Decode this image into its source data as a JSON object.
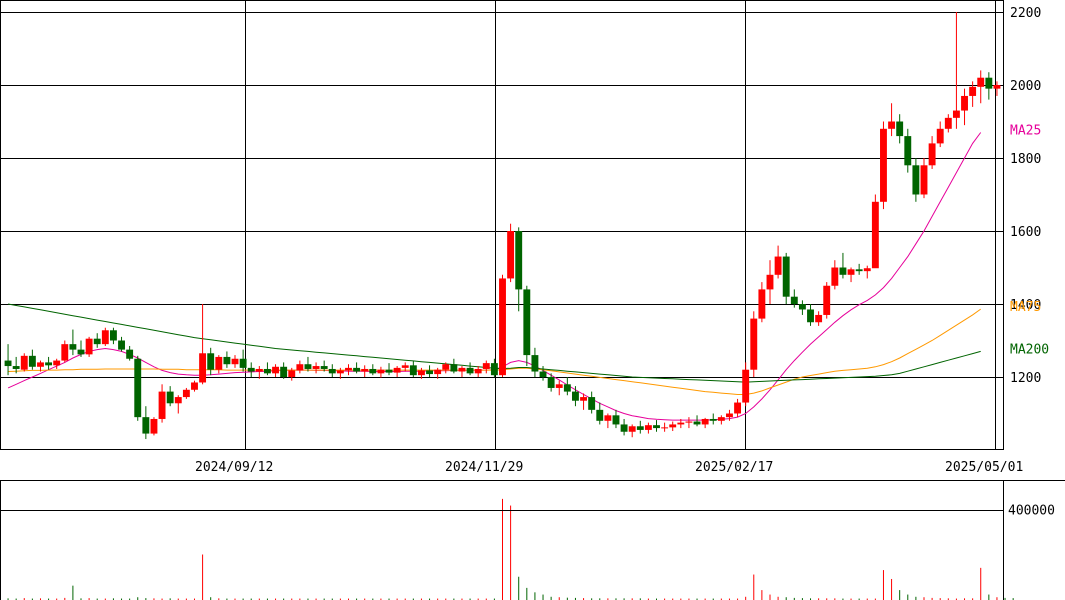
{
  "chart_data": [
    {
      "type": "candlestick",
      "panel": "price",
      "x_ticks": [
        "2024/09/12",
        "2024/11/29",
        "2025/02/17",
        "2025/05/01"
      ],
      "y_ticks": [
        1200,
        1400,
        1600,
        1800,
        2000,
        2200
      ],
      "ylim": [
        1020,
        2220
      ],
      "grid": true,
      "up_color": "#ff0000",
      "down_color": "#006400",
      "candles": [
        [
          1245,
          1290,
          1205,
          1230
        ],
        [
          1230,
          1255,
          1210,
          1222
        ],
        [
          1220,
          1265,
          1215,
          1258
        ],
        [
          1258,
          1275,
          1220,
          1228
        ],
        [
          1228,
          1245,
          1215,
          1240
        ],
        [
          1240,
          1255,
          1220,
          1232
        ],
        [
          1232,
          1250,
          1222,
          1245
        ],
        [
          1245,
          1300,
          1240,
          1290
        ],
        [
          1290,
          1330,
          1260,
          1275
        ],
        [
          1275,
          1300,
          1255,
          1262
        ],
        [
          1262,
          1310,
          1255,
          1305
        ],
        [
          1305,
          1320,
          1280,
          1290
        ],
        [
          1290,
          1335,
          1285,
          1328
        ],
        [
          1328,
          1335,
          1290,
          1300
        ],
        [
          1300,
          1310,
          1270,
          1275
        ],
        [
          1275,
          1285,
          1245,
          1250
        ],
        [
          1250,
          1258,
          1080,
          1090
        ],
        [
          1090,
          1120,
          1030,
          1045
        ],
        [
          1045,
          1090,
          1040,
          1085
        ],
        [
          1085,
          1180,
          1075,
          1160
        ],
        [
          1160,
          1175,
          1120,
          1128
        ],
        [
          1128,
          1150,
          1100,
          1145
        ],
        [
          1145,
          1170,
          1140,
          1165
        ],
        [
          1165,
          1190,
          1160,
          1185
        ],
        [
          1185,
          1400,
          1180,
          1265
        ],
        [
          1265,
          1280,
          1205,
          1220
        ],
        [
          1220,
          1260,
          1210,
          1255
        ],
        [
          1255,
          1270,
          1225,
          1235
        ],
        [
          1235,
          1260,
          1225,
          1250
        ],
        [
          1250,
          1275,
          1215,
          1225
        ],
        [
          1225,
          1240,
          1200,
          1215
        ],
        [
          1215,
          1230,
          1195,
          1222
        ],
        [
          1222,
          1240,
          1205,
          1210
        ],
        [
          1210,
          1235,
          1200,
          1228
        ],
        [
          1228,
          1240,
          1195,
          1200
        ],
        [
          1200,
          1225,
          1190,
          1218
        ],
        [
          1218,
          1245,
          1210,
          1235
        ],
        [
          1235,
          1255,
          1215,
          1222
        ],
        [
          1222,
          1240,
          1210,
          1230
        ],
        [
          1230,
          1245,
          1215,
          1222
        ],
        [
          1222,
          1235,
          1200,
          1210
        ],
        [
          1210,
          1225,
          1195,
          1218
        ],
        [
          1218,
          1235,
          1205,
          1225
        ],
        [
          1225,
          1240,
          1210,
          1215
        ],
        [
          1215,
          1232,
          1200,
          1222
        ],
        [
          1222,
          1235,
          1205,
          1210
        ],
        [
          1210,
          1228,
          1198,
          1220
        ],
        [
          1220,
          1238,
          1205,
          1212
        ],
        [
          1212,
          1230,
          1200,
          1225
        ],
        [
          1225,
          1240,
          1215,
          1232
        ],
        [
          1232,
          1245,
          1200,
          1205
        ],
        [
          1205,
          1225,
          1195,
          1218
        ],
        [
          1218,
          1232,
          1200,
          1208
        ],
        [
          1208,
          1225,
          1195,
          1220
        ],
        [
          1220,
          1240,
          1210,
          1235
        ],
        [
          1235,
          1250,
          1210,
          1215
        ],
        [
          1215,
          1230,
          1200,
          1225
        ],
        [
          1225,
          1240,
          1205,
          1210
        ],
        [
          1210,
          1230,
          1200,
          1222
        ],
        [
          1222,
          1245,
          1210,
          1238
        ],
        [
          1238,
          1250,
          1200,
          1205
        ],
        [
          1205,
          1480,
          1200,
          1470
        ],
        [
          1470,
          1620,
          1460,
          1600
        ],
        [
          1600,
          1610,
          1380,
          1440
        ],
        [
          1440,
          1450,
          1230,
          1260
        ],
        [
          1260,
          1280,
          1200,
          1215
        ],
        [
          1215,
          1230,
          1190,
          1200
        ],
        [
          1200,
          1210,
          1160,
          1170
        ],
        [
          1170,
          1190,
          1150,
          1180
        ],
        [
          1180,
          1200,
          1150,
          1160
        ],
        [
          1160,
          1175,
          1120,
          1135
        ],
        [
          1135,
          1155,
          1110,
          1145
        ],
        [
          1145,
          1160,
          1100,
          1110
        ],
        [
          1110,
          1130,
          1070,
          1080
        ],
        [
          1080,
          1100,
          1060,
          1095
        ],
        [
          1095,
          1110,
          1060,
          1070
        ],
        [
          1070,
          1085,
          1040,
          1050
        ],
        [
          1050,
          1070,
          1035,
          1065
        ],
        [
          1065,
          1080,
          1045,
          1055
        ],
        [
          1055,
          1075,
          1045,
          1068
        ],
        [
          1068,
          1082,
          1050,
          1060
        ],
        [
          1060,
          1075,
          1050,
          1062
        ],
        [
          1062,
          1078,
          1052,
          1070
        ],
        [
          1070,
          1085,
          1060,
          1075
        ],
        [
          1075,
          1090,
          1060,
          1078
        ],
        [
          1078,
          1095,
          1065,
          1070
        ],
        [
          1070,
          1088,
          1060,
          1085
        ],
        [
          1085,
          1100,
          1070,
          1080
        ],
        [
          1080,
          1095,
          1070,
          1090
        ],
        [
          1090,
          1110,
          1080,
          1100
        ],
        [
          1100,
          1140,
          1090,
          1130
        ],
        [
          1130,
          1240,
          1120,
          1220
        ],
        [
          1220,
          1380,
          1200,
          1360
        ],
        [
          1360,
          1460,
          1350,
          1440
        ],
        [
          1440,
          1520,
          1400,
          1480
        ],
        [
          1480,
          1560,
          1470,
          1530
        ],
        [
          1530,
          1540,
          1400,
          1420
        ],
        [
          1420,
          1440,
          1390,
          1400
        ],
        [
          1400,
          1410,
          1370,
          1385
        ],
        [
          1385,
          1400,
          1340,
          1350
        ],
        [
          1350,
          1380,
          1340,
          1370
        ],
        [
          1370,
          1460,
          1360,
          1450
        ],
        [
          1450,
          1520,
          1440,
          1500
        ],
        [
          1500,
          1540,
          1470,
          1480
        ],
        [
          1480,
          1500,
          1460,
          1495
        ],
        [
          1495,
          1510,
          1480,
          1490
        ],
        [
          1490,
          1505,
          1470,
          1498
        ],
        [
          1498,
          1700,
          1620,
          1680
        ],
        [
          1680,
          1900,
          1660,
          1880
        ],
        [
          1880,
          1950,
          1860,
          1900
        ],
        [
          1900,
          1920,
          1840,
          1860
        ],
        [
          1860,
          1880,
          1760,
          1780
        ],
        [
          1780,
          1800,
          1680,
          1700
        ],
        [
          1700,
          1800,
          1690,
          1780
        ],
        [
          1780,
          1860,
          1770,
          1840
        ],
        [
          1840,
          1900,
          1830,
          1880
        ],
        [
          1880,
          1920,
          1870,
          1910
        ],
        [
          1910,
          2200,
          1880,
          1930
        ],
        [
          1930,
          1990,
          1890,
          1970
        ],
        [
          1970,
          2010,
          1940,
          1995
        ],
        [
          1995,
          2040,
          1950,
          2020
        ],
        [
          2020,
          2035,
          1960,
          1990
        ],
        [
          1990,
          2010,
          1970,
          2000
        ]
      ],
      "series": [
        {
          "name": "MA25",
          "color": "#e6009a",
          "values": [
            1170,
            1180,
            1190,
            1200,
            1210,
            1220,
            1230,
            1240,
            1252,
            1262,
            1270,
            1275,
            1278,
            1275,
            1270,
            1262,
            1252,
            1240,
            1228,
            1218,
            1212,
            1208,
            1206,
            1205,
            1205,
            1206,
            1208,
            1210,
            1212,
            1213,
            1214,
            1215,
            1216,
            1217,
            1218,
            1219,
            1219,
            1219,
            1218,
            1218,
            1217,
            1217,
            1216,
            1216,
            1216,
            1215,
            1215,
            1215,
            1215,
            1216,
            1216,
            1216,
            1217,
            1217,
            1217,
            1218,
            1218,
            1218,
            1219,
            1219,
            1220,
            1228,
            1240,
            1245,
            1240,
            1230,
            1218,
            1205,
            1192,
            1178,
            1165,
            1152,
            1140,
            1128,
            1118,
            1108,
            1100,
            1094,
            1090,
            1086,
            1084,
            1083,
            1082,
            1082,
            1082,
            1082,
            1082,
            1083,
            1084,
            1086,
            1090,
            1100,
            1118,
            1140,
            1165,
            1192,
            1220,
            1245,
            1268,
            1290,
            1310,
            1330,
            1350,
            1368,
            1384,
            1398,
            1410,
            1425,
            1445,
            1470,
            1500,
            1530,
            1565,
            1600,
            1640,
            1680,
            1720,
            1760,
            1800,
            1840,
            1870
          ]
        },
        {
          "name": "MA75",
          "color": "#ff9900",
          "values": [
            1215,
            1216,
            1217,
            1218,
            1218,
            1219,
            1219,
            1220,
            1220,
            1221,
            1221,
            1221,
            1222,
            1222,
            1222,
            1222,
            1222,
            1222,
            1222,
            1221,
            1221,
            1221,
            1220,
            1220,
            1220,
            1220,
            1220,
            1219,
            1219,
            1219,
            1219,
            1219,
            1219,
            1219,
            1219,
            1219,
            1219,
            1219,
            1219,
            1219,
            1219,
            1219,
            1219,
            1219,
            1219,
            1219,
            1219,
            1219,
            1219,
            1219,
            1219,
            1219,
            1219,
            1219,
            1219,
            1219,
            1219,
            1219,
            1219,
            1219,
            1219,
            1220,
            1222,
            1224,
            1224,
            1222,
            1220,
            1217,
            1214,
            1211,
            1208,
            1205,
            1202,
            1199,
            1196,
            1193,
            1190,
            1187,
            1184,
            1181,
            1178,
            1175,
            1172,
            1169,
            1166,
            1163,
            1160,
            1158,
            1156,
            1154,
            1152,
            1152,
            1156,
            1162,
            1170,
            1178,
            1186,
            1194,
            1200,
            1204,
            1208,
            1212,
            1216,
            1218,
            1220,
            1222,
            1224,
            1228,
            1234,
            1242,
            1252,
            1264,
            1276,
            1288,
            1300,
            1314,
            1328,
            1342,
            1356,
            1370,
            1386
          ]
        },
        {
          "name": "MA200",
          "color": "#006400",
          "values": [
            1400,
            1396,
            1392,
            1388,
            1384,
            1380,
            1376,
            1372,
            1368,
            1364,
            1360,
            1356,
            1352,
            1348,
            1344,
            1340,
            1336,
            1332,
            1328,
            1324,
            1320,
            1316,
            1312,
            1308,
            1305,
            1302,
            1299,
            1296,
            1293,
            1290,
            1287,
            1284,
            1281,
            1278,
            1276,
            1274,
            1272,
            1270,
            1268,
            1266,
            1264,
            1262,
            1260,
            1258,
            1256,
            1254,
            1252,
            1250,
            1248,
            1246,
            1244,
            1242,
            1240,
            1238,
            1236,
            1234,
            1232,
            1230,
            1228,
            1226,
            1224,
            1223,
            1224,
            1226,
            1226,
            1224,
            1222,
            1220,
            1218,
            1216,
            1214,
            1212,
            1210,
            1208,
            1206,
            1204,
            1202,
            1200,
            1199,
            1198,
            1197,
            1196,
            1195,
            1194,
            1193,
            1192,
            1191,
            1190,
            1189,
            1188,
            1187,
            1186,
            1187,
            1188,
            1189,
            1190,
            1191,
            1192,
            1193,
            1194,
            1195,
            1196,
            1197,
            1198,
            1199,
            1200,
            1201,
            1202,
            1204,
            1206,
            1210,
            1216,
            1222,
            1228,
            1234,
            1240,
            1246,
            1252,
            1258,
            1264,
            1270
          ]
        }
      ],
      "ma_labels": [
        "MA25",
        "MA75",
        "MA200"
      ]
    },
    {
      "type": "bar",
      "panel": "volume",
      "y_ticks": [
        400000
      ],
      "ylim": [
        0,
        530000
      ],
      "grid": true,
      "values": [
        3000,
        2000,
        4000,
        2000,
        3000,
        2000,
        2000,
        5000,
        60000,
        3000,
        4000,
        2000,
        2000,
        3000,
        2000,
        2000,
        8000,
        4000,
        3000,
        2000,
        3000,
        2000,
        2000,
        2000,
        200000,
        8000,
        3000,
        2000,
        2000,
        2000,
        2000,
        2000,
        2000,
        2000,
        2000,
        2000,
        2000,
        2000,
        2000,
        2000,
        2000,
        2000,
        2000,
        2000,
        2000,
        2000,
        2000,
        2000,
        2000,
        2000,
        2000,
        2000,
        2000,
        2000,
        2000,
        2000,
        2000,
        2000,
        2000,
        2000,
        2000,
        450000,
        420000,
        100000,
        50000,
        30000,
        20000,
        10000,
        8000,
        6000,
        5000,
        4000,
        3000,
        3000,
        3000,
        3000,
        3000,
        3000,
        3000,
        2000,
        2000,
        2000,
        2000,
        2000,
        2000,
        2000,
        2000,
        2000,
        2000,
        2000,
        2000,
        10000,
        110000,
        40000,
        20000,
        10000,
        8000,
        5000,
        4000,
        3000,
        3000,
        3000,
        3000,
        2000,
        2000,
        2000,
        2000,
        2000,
        130000,
        90000,
        40000,
        20000,
        10000,
        8000,
        5000,
        4000,
        3000,
        2000,
        3000,
        3000,
        140000,
        20000,
        8000,
        5000,
        4000
      ]
    }
  ]
}
